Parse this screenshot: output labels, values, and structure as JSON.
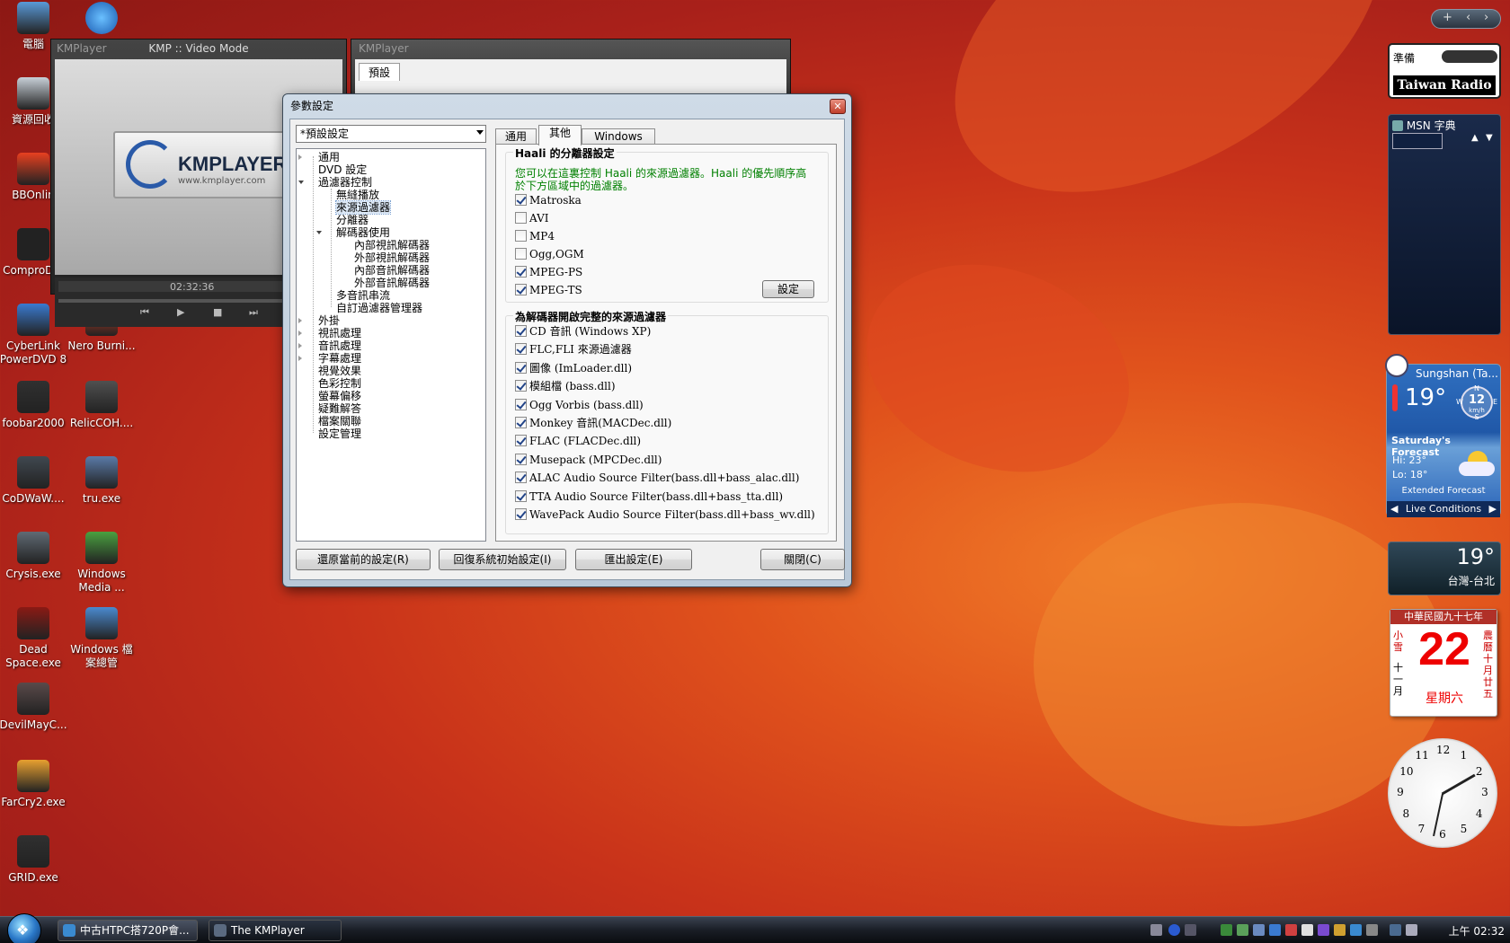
{
  "desktop_icons": [
    {
      "label": "電腦",
      "color": "#5a9ad8"
    },
    {
      "label": "資源回收",
      "color": "#c8d0d8"
    },
    {
      "label": "BBOnlin",
      "color": "#e84020"
    },
    {
      "label": "ComproD 4",
      "color": "#222222"
    },
    {
      "label": "CyberLink PowerDVD 8",
      "color": "#3a7ad0"
    },
    {
      "label": "foobar2000",
      "color": "#303030"
    },
    {
      "label": "CoDWaW....",
      "color": "#404850"
    },
    {
      "label": "Crysis.exe",
      "color": "#606a74"
    },
    {
      "label": "Dead Space.exe",
      "color": "#8a1a14"
    },
    {
      "label": "DevilMayC...",
      "color": "#5a4a4a"
    },
    {
      "label": "FarCry2.exe",
      "color": "#e8a030"
    },
    {
      "label": "GRID.exe",
      "color": "#303030"
    }
  ],
  "desktop_icons2": [
    {
      "label": "Nero Burni...",
      "color": "#e84020"
    },
    {
      "label": "RelicCOH....",
      "color": "#505050"
    },
    {
      "label": "tru.exe",
      "color": "#5a7aa8"
    },
    {
      "label": "Windows Media ...",
      "color": "#4aa040"
    },
    {
      "label": "Windows 檔案總管",
      "color": "#4a8ad0"
    }
  ],
  "kmp_window": {
    "left_title": "KMPlayer",
    "title": "KMP :: Video Mode",
    "logo_text": "KMPLAYER",
    "logo_url": "www.kmplayer.com",
    "time": "02:32:36"
  },
  "kmp_window2": {
    "title": "KMPlayer",
    "tab": "預設"
  },
  "dialog": {
    "title": "參數設定",
    "preset_combo": "*預設設定",
    "tree": [
      {
        "label": "通用",
        "level": 0,
        "twisty": "col"
      },
      {
        "label": "DVD 設定",
        "level": 0,
        "twisty": ""
      },
      {
        "label": "過濾器控制",
        "level": 0,
        "twisty": "exp"
      },
      {
        "label": "無縫播放",
        "level": 1,
        "twisty": ""
      },
      {
        "label": "來源過濾器",
        "level": 1,
        "twisty": "",
        "selected": true
      },
      {
        "label": "分離器",
        "level": 1,
        "twisty": ""
      },
      {
        "label": "解碼器使用",
        "level": 1,
        "twisty": "exp"
      },
      {
        "label": "內部視訊解碼器",
        "level": 2,
        "twisty": ""
      },
      {
        "label": "外部視訊解碼器",
        "level": 2,
        "twisty": ""
      },
      {
        "label": "內部音訊解碼器",
        "level": 2,
        "twisty": ""
      },
      {
        "label": "外部音訊解碼器",
        "level": 2,
        "twisty": ""
      },
      {
        "label": "多音訊串流",
        "level": 1,
        "twisty": ""
      },
      {
        "label": "自訂過濾器管理器",
        "level": 1,
        "twisty": ""
      },
      {
        "label": "外掛",
        "level": 0,
        "twisty": "col"
      },
      {
        "label": "視訊處理",
        "level": 0,
        "twisty": "col"
      },
      {
        "label": "音訊處理",
        "level": 0,
        "twisty": "col"
      },
      {
        "label": "字幕處理",
        "level": 0,
        "twisty": "col"
      },
      {
        "label": "視覺效果",
        "level": 0,
        "twisty": ""
      },
      {
        "label": "色彩控制",
        "level": 0,
        "twisty": ""
      },
      {
        "label": "螢幕偏移",
        "level": 0,
        "twisty": ""
      },
      {
        "label": "疑難解答",
        "level": 0,
        "twisty": ""
      },
      {
        "label": "檔案關聯",
        "level": 0,
        "twisty": ""
      },
      {
        "label": "設定管理",
        "level": 0,
        "twisty": ""
      }
    ],
    "tabs": [
      {
        "label": "通用",
        "active": false
      },
      {
        "label": "其他",
        "active": true
      },
      {
        "label": "Windows Media",
        "active": false
      }
    ],
    "group1": {
      "title": "Haali 的分離器設定",
      "description": "您可以在這裏控制 Haali 的來源過濾器。Haali 的優先順序高於下方區域中的過濾器。",
      "items": [
        {
          "label": "Matroska",
          "checked": true
        },
        {
          "label": "AVI",
          "checked": false
        },
        {
          "label": "MP4",
          "checked": false
        },
        {
          "label": "Ogg,OGM",
          "checked": false
        },
        {
          "label": "MPEG-PS",
          "checked": true
        },
        {
          "label": "MPEG-TS",
          "checked": true
        }
      ],
      "settings_button": "設定"
    },
    "group2": {
      "title": "為解碼器開啟完整的來源過濾器",
      "items": [
        {
          "label": "CD 音訊 (Windows XP)",
          "checked": true
        },
        {
          "label": "FLC,FLI 來源過濾器",
          "checked": true
        },
        {
          "label": "圖像 (ImLoader.dll)",
          "checked": true
        },
        {
          "label": "模組檔 (bass.dll)",
          "checked": true
        },
        {
          "label": "Ogg Vorbis (bass.dll)",
          "checked": true
        },
        {
          "label": "Monkey 音訊(MACDec.dll)",
          "checked": true
        },
        {
          "label": "FLAC (FLACDec.dll)",
          "checked": true
        },
        {
          "label": "Musepack (MPCDec.dll)",
          "checked": true
        },
        {
          "label": "ALAC Audio Source Filter(bass.dll+bass_alac.dll)",
          "checked": true
        },
        {
          "label": "TTA Audio Source Filter(bass.dll+bass_tta.dll)",
          "checked": true
        },
        {
          "label": "WavePack Audio Source Filter(bass.dll+bass_wv.dll)",
          "checked": true
        }
      ]
    },
    "buttons": {
      "restore_current": "還原當前的設定(R)",
      "restore_default": "回復系統初始設定(I)",
      "export": "匯出設定(E)",
      "close": "關閉(C)"
    }
  },
  "taskbar": {
    "tasks": [
      {
        "label": "中古HTPC搭720P會...",
        "active": false
      },
      {
        "label": "The KMPlayer",
        "active": true
      }
    ],
    "clock": "上午 02:32"
  },
  "gadgets": {
    "radio_status": "準備",
    "radio_name": "Taiwan Radio",
    "msn_title": "MSN 字典",
    "weather_city": "Sungshan (Ta...",
    "weather_temp": "19°",
    "wind_speed": "12",
    "wind_unit": "km/h",
    "compass": {
      "n": "N",
      "s": "S",
      "e": "E",
      "w": "W"
    },
    "forecast_title": "Saturday's Forecast",
    "forecast_hi": "Hi: 23°",
    "forecast_lo": "Lo: 18°",
    "extended": "Extended Forecast",
    "live": "Live Conditions",
    "weather2_temp": "19°",
    "weather2_city": "台灣-台北",
    "calendar_header": "中華民國九十七年",
    "calendar_left_top": "小雪",
    "calendar_left_bottom": "十一月",
    "calendar_day": "22",
    "calendar_weekday": "星期六",
    "calendar_right": "農曆十月廿五",
    "clock_numbers": [
      "12",
      "1",
      "2",
      "3",
      "4",
      "5",
      "6",
      "7",
      "8",
      "9",
      "10",
      "11"
    ]
  }
}
